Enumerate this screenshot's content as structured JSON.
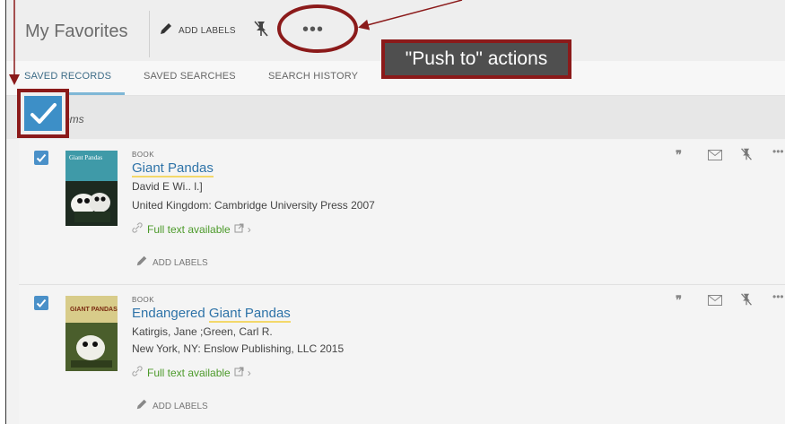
{
  "header": {
    "title": "My Favorites",
    "add_labels": "ADD LABELS",
    "more_actions": "•••"
  },
  "tabs": [
    {
      "label": "SAVED RECORDS",
      "active": true
    },
    {
      "label": "SAVED SEARCHES",
      "active": false
    },
    {
      "label": "SEARCH HISTORY",
      "active": false
    }
  ],
  "callout": {
    "text": "\"Push to\" actions"
  },
  "selection": {
    "label": "items"
  },
  "records": [
    {
      "type": "BOOK",
      "title_highlight": "Giant Pandas",
      "title_prefix": "",
      "author": "David E Wi.. l.]",
      "publisher": "United Kingdom: Cambridge University Press 2007",
      "fulltext": "Full text available",
      "add_labels": "ADD LABELS",
      "cover_text": "Giant Pandas"
    },
    {
      "type": "BOOK",
      "title_prefix": "Endangered ",
      "title_highlight": "Giant Pandas",
      "author": "Katirgis, Jane ;Green, Carl R.",
      "publisher": "New York, NY: Enslow Publishing, LLC 2015",
      "fulltext": "Full text available",
      "add_labels": "ADD LABELS",
      "cover_text": "GIANT PANDAS"
    }
  ],
  "record_actions": {
    "cite_icon": "quote-icon",
    "email_icon": "envelope-icon",
    "unpin_icon": "unpin-icon",
    "more": "•••"
  },
  "colors": {
    "accent": "#3d8fc7",
    "highlight_red": "#8b1a1a",
    "link_blue": "#2e73a8",
    "available_green": "#4c9a2a"
  }
}
